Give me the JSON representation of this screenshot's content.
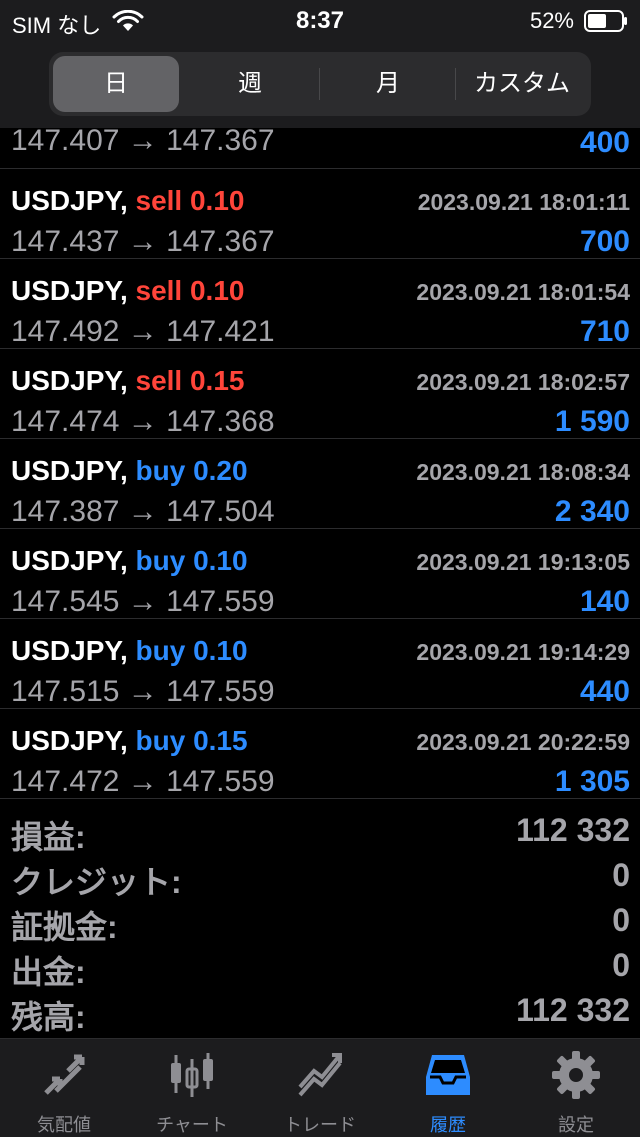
{
  "status_bar": {
    "carrier": "SIM なし",
    "time": "8:37",
    "battery": "52%"
  },
  "segments": [
    "日",
    "週",
    "月",
    "カスタム"
  ],
  "active_segment": "日",
  "first_row": {
    "prices": "147.407 → 147.367",
    "profit": "400"
  },
  "trades": [
    {
      "symbol": "USDJPY,",
      "side": "sell",
      "volume": "0.10",
      "datetime": "2023.09.21 18:01:11",
      "prices": "147.437 → 147.367",
      "profit": "700"
    },
    {
      "symbol": "USDJPY,",
      "side": "sell",
      "volume": "0.10",
      "datetime": "2023.09.21 18:01:54",
      "prices": "147.492 → 147.421",
      "profit": "710"
    },
    {
      "symbol": "USDJPY,",
      "side": "sell",
      "volume": "0.15",
      "datetime": "2023.09.21 18:02:57",
      "prices": "147.474 → 147.368",
      "profit": "1 590"
    },
    {
      "symbol": "USDJPY,",
      "side": "buy",
      "volume": "0.20",
      "datetime": "2023.09.21 18:08:34",
      "prices": "147.387 → 147.504",
      "profit": "2 340"
    },
    {
      "symbol": "USDJPY,",
      "side": "buy",
      "volume": "0.10",
      "datetime": "2023.09.21 19:13:05",
      "prices": "147.545 → 147.559",
      "profit": "140"
    },
    {
      "symbol": "USDJPY,",
      "side": "buy",
      "volume": "0.10",
      "datetime": "2023.09.21 19:14:29",
      "prices": "147.515 → 147.559",
      "profit": "440"
    },
    {
      "symbol": "USDJPY,",
      "side": "buy",
      "volume": "0.15",
      "datetime": "2023.09.21 20:22:59",
      "prices": "147.472 → 147.559",
      "profit": "1 305"
    }
  ],
  "summary": [
    {
      "label": "損益:",
      "value": "112 332"
    },
    {
      "label": "クレジット:",
      "value": "0"
    },
    {
      "label": "証拠金:",
      "value": "0"
    },
    {
      "label": "出金:",
      "value": "0"
    },
    {
      "label": "残高:",
      "value": "112 332"
    }
  ],
  "tabs": [
    {
      "label": "気配値",
      "icon": "quotes-arrows-icon"
    },
    {
      "label": "チャート",
      "icon": "candlestick-chart-icon"
    },
    {
      "label": "トレード",
      "icon": "trade-trend-icon"
    },
    {
      "label": "履歴",
      "icon": "history-inbox-icon"
    },
    {
      "label": "設定",
      "icon": "gear-icon"
    }
  ],
  "active_tab": "履歴",
  "colors": {
    "sell": "#ff453a",
    "buy": "#2d8cff",
    "profit": "#2d8cff",
    "muted": "#a5a5aa",
    "background": "#000000"
  }
}
